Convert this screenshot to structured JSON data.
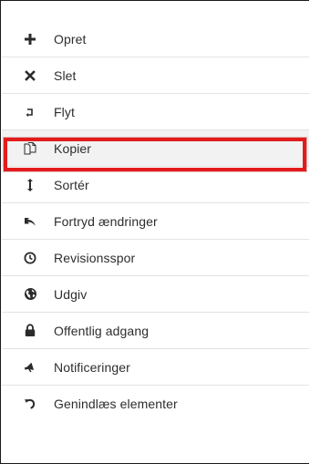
{
  "menu": {
    "items": [
      {
        "label": "Opret",
        "icon": "plus-icon"
      },
      {
        "label": "Slet",
        "icon": "close-icon"
      },
      {
        "label": "Flyt",
        "icon": "move-arrow-icon"
      },
      {
        "label": "Kopier",
        "icon": "copy-document-icon",
        "selected": true
      },
      {
        "label": "Sortér",
        "icon": "sort-vertical-icon"
      },
      {
        "label": "Fortryd ændringer",
        "icon": "undo-icon"
      },
      {
        "label": "Revisionsspor",
        "icon": "clock-icon"
      },
      {
        "label": "Udgiv",
        "icon": "globe-icon"
      },
      {
        "label": "Offentlig adgang",
        "icon": "lock-icon"
      },
      {
        "label": "Notificeringer",
        "icon": "megaphone-icon"
      },
      {
        "label": "Genindlæs elementer",
        "icon": "reload-icon"
      }
    ]
  },
  "colors": {
    "highlight_border": "#e21c1c",
    "selected_background": "#f2f2f2",
    "text": "#2d2d2d",
    "divider": "#e3e3e3"
  }
}
